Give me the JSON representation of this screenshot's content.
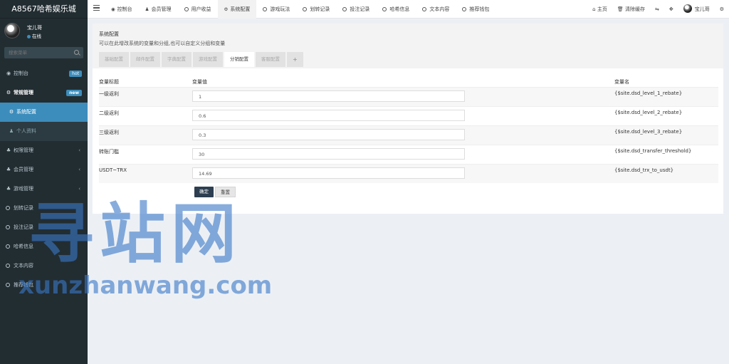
{
  "brand": "A8567哈希娱乐城",
  "user": {
    "name": "宝儿哥",
    "status": "在线"
  },
  "search": {
    "placeholder": "搜索菜单"
  },
  "sidebar": {
    "items": [
      {
        "label": "控制台",
        "icon": "dashboard-icon",
        "badge": "hot"
      },
      {
        "label": "常规管理",
        "icon": "cogs-icon",
        "badge": "new"
      },
      {
        "label": "系统配置",
        "icon": "cog-icon"
      },
      {
        "label": "个人资料",
        "icon": "user-icon"
      },
      {
        "label": "权限管理",
        "icon": "group-icon"
      },
      {
        "label": "会员管理",
        "icon": "group-icon"
      },
      {
        "label": "游戏管理",
        "icon": "group-icon"
      },
      {
        "label": "划转记录",
        "icon": "circle-icon"
      },
      {
        "label": "投注记录",
        "icon": "circle-icon"
      },
      {
        "label": "哈希信息",
        "icon": "circle-icon"
      },
      {
        "label": "文本内容",
        "icon": "circle-icon"
      },
      {
        "label": "推荐钱包",
        "icon": "circle-icon"
      }
    ]
  },
  "topnav": {
    "tabs": [
      {
        "label": "控制台",
        "icon": "dashboard-icon"
      },
      {
        "label": "会员管理",
        "icon": "user-icon"
      },
      {
        "label": "用户收益",
        "icon": "circle-icon"
      },
      {
        "label": "系统配置",
        "icon": "cog-icon"
      },
      {
        "label": "游戏玩法",
        "icon": "circle-icon"
      },
      {
        "label": "划转记录",
        "icon": "circle-icon"
      },
      {
        "label": "投注记录",
        "icon": "circle-icon"
      },
      {
        "label": "哈希信息",
        "icon": "circle-icon"
      },
      {
        "label": "文本内容",
        "icon": "circle-icon"
      },
      {
        "label": "推荐钱包",
        "icon": "circle-icon"
      }
    ],
    "home": "主页",
    "clear_cache": "清除缓存",
    "user": "宝儿哥"
  },
  "panel": {
    "title": "系统配置",
    "description": "可以在此增改系统的变量和分组,也可以自定义分组和变量",
    "tabs": [
      "基础配置",
      "邮件配置",
      "字典配置",
      "游戏配置",
      "分销配置",
      "客服配置"
    ],
    "plus": "+"
  },
  "table": {
    "headers": [
      "变量标题",
      "变量值",
      "变量名"
    ],
    "rows": [
      {
        "title": "一级返利",
        "value": "1",
        "name": "{$site.dsd_level_1_rebate}"
      },
      {
        "title": "二级返利",
        "value": "0.6",
        "name": "{$site.dsd_level_2_rebate}"
      },
      {
        "title": "三级返利",
        "value": "0.3",
        "name": "{$site.dsd_level_3_rebate}"
      },
      {
        "title": "转账门槛",
        "value": "30",
        "name": "{$site.dsd_transfer_threshold}"
      },
      {
        "title": "USDT~TRX",
        "value": "14.69",
        "name": "{$site.dsd_trx_to_usdt}"
      }
    ]
  },
  "buttons": {
    "submit": "确定",
    "reset": "重置"
  },
  "watermark": {
    "cn": "寻站网",
    "en": "xunzhanwang.com"
  }
}
